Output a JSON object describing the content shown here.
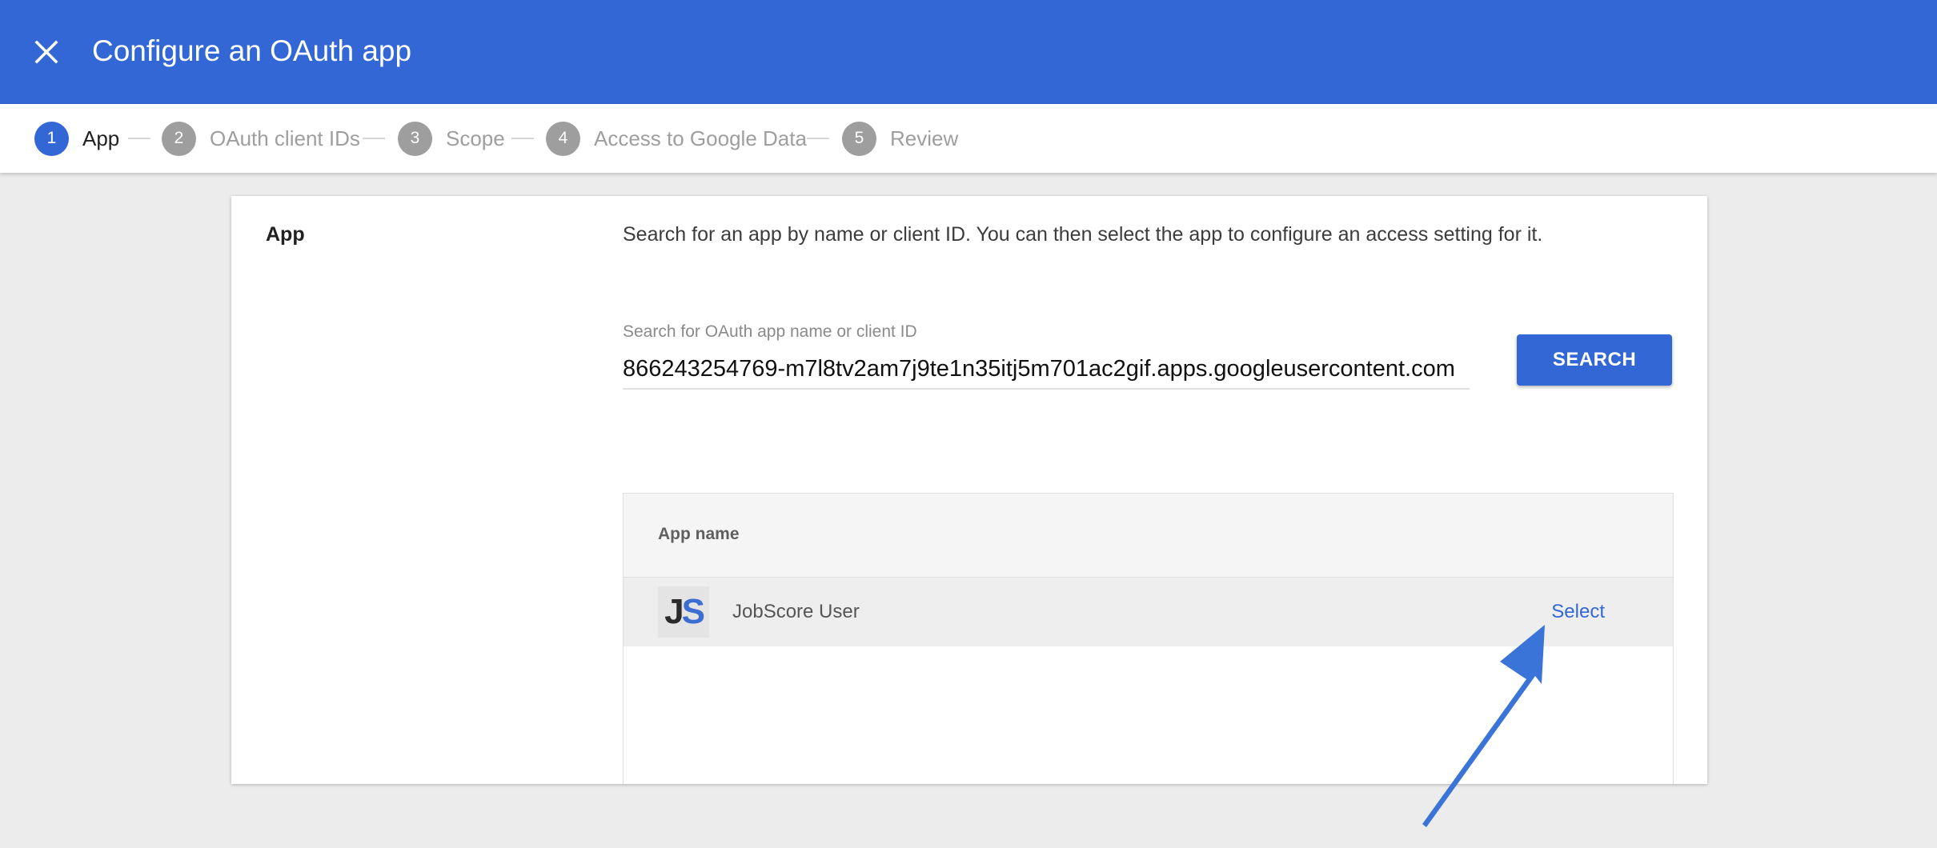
{
  "header": {
    "title": "Configure an OAuth app",
    "close_icon": "close-icon",
    "background_color": "#3367d6"
  },
  "stepper": {
    "steps": [
      {
        "number": "1",
        "label": "App",
        "active": true
      },
      {
        "number": "2",
        "label": "OAuth client IDs",
        "active": false
      },
      {
        "number": "3",
        "label": "Scope",
        "active": false
      },
      {
        "number": "4",
        "label": "Access to Google Data",
        "active": false
      },
      {
        "number": "5",
        "label": "Review",
        "active": false
      }
    ]
  },
  "card": {
    "section_label": "App",
    "description": "Search for an app by name or client ID. You can then select the app to configure an access setting for it.",
    "search": {
      "label": "Search for OAuth app name or client ID",
      "value": "866243254769-m7l8tv2am7j9te1n35itj5m701ac2gif.apps.googleusercontent.com",
      "button_label": "SEARCH"
    },
    "table": {
      "column_header": "App name",
      "rows": [
        {
          "logo_text_j": "J",
          "logo_text_s": "S",
          "name": "JobScore User",
          "action": "Select"
        }
      ]
    }
  },
  "annotation": {
    "arrow_icon": "pointer-arrow-icon",
    "arrow_color": "#3a74d8"
  }
}
